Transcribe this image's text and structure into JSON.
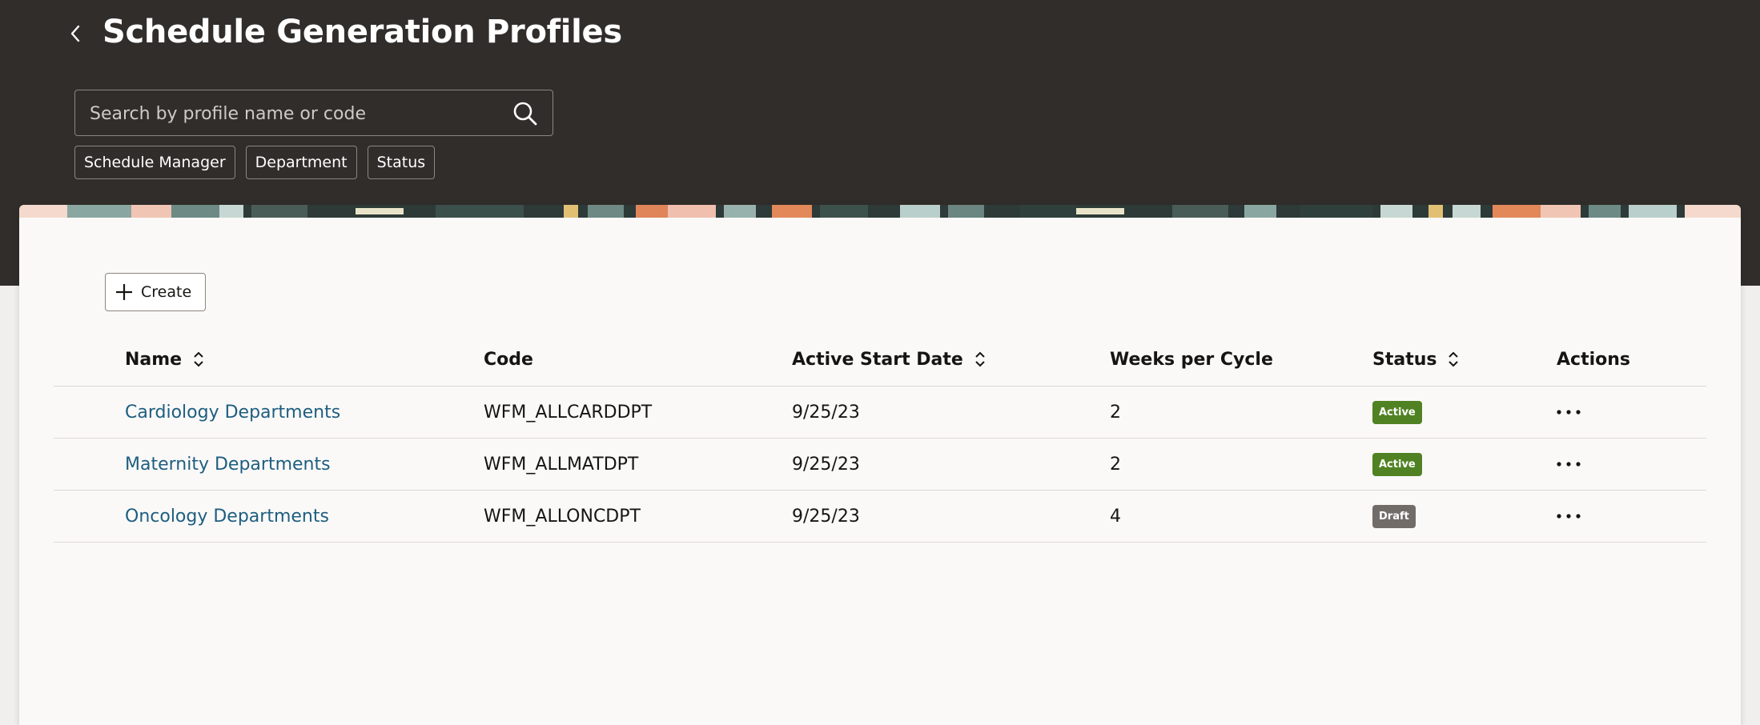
{
  "header": {
    "title": "Schedule Generation Profiles",
    "back_icon": "chevron-left-icon"
  },
  "search": {
    "placeholder": "Search by profile name or code",
    "value": "",
    "icon": "search-icon"
  },
  "filters": [
    {
      "label": "Schedule Manager"
    },
    {
      "label": "Department"
    },
    {
      "label": "Status"
    }
  ],
  "toolbar": {
    "create_label": "Create",
    "create_icon": "plus-icon"
  },
  "table": {
    "columns": {
      "name": "Name",
      "code": "Code",
      "date": "Active Start Date",
      "weeks": "Weeks per Cycle",
      "status": "Status",
      "actions": "Actions"
    },
    "rows": [
      {
        "name": "Cardiology Departments",
        "code": "WFM_ALLCARDDPT",
        "date": "9/25/23",
        "weeks": "2",
        "status": "Active"
      },
      {
        "name": "Maternity Departments",
        "code": "WFM_ALLMATDPT",
        "date": "9/25/23",
        "weeks": "2",
        "status": "Active"
      },
      {
        "name": "Oncology Departments",
        "code": "WFM_ALLONCDPT",
        "date": "9/25/23",
        "weeks": "4",
        "status": "Draft"
      }
    ]
  },
  "colors": {
    "header_bg": "#312d2a",
    "link": "#1e5e80",
    "status_active": "#508223",
    "status_draft": "#716c68"
  }
}
